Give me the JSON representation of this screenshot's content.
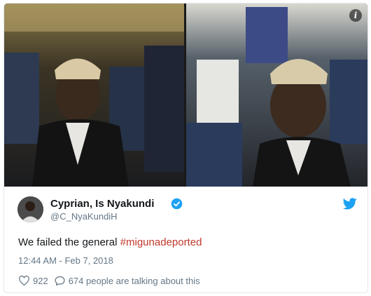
{
  "tweet": {
    "author_name": "Cyprian, Is Nyakundi",
    "handle": "@C_NyaKundiH",
    "text_prefix": "We failed the general ",
    "hashtag": "#migunadeported",
    "timestamp": "12:44 AM - Feb 7, 2018",
    "likes": "922",
    "talking": "674 people are talking about this"
  },
  "icons": {
    "info": "info-icon",
    "verified": "verified-badge-icon",
    "bird": "twitter-bird-icon",
    "like": "heart-icon",
    "reply": "speech-bubble-icon"
  },
  "colors": {
    "text": "#14171a",
    "muted": "#657786",
    "hashtag": "#c0392b",
    "twitter_blue": "#1da1f2"
  }
}
